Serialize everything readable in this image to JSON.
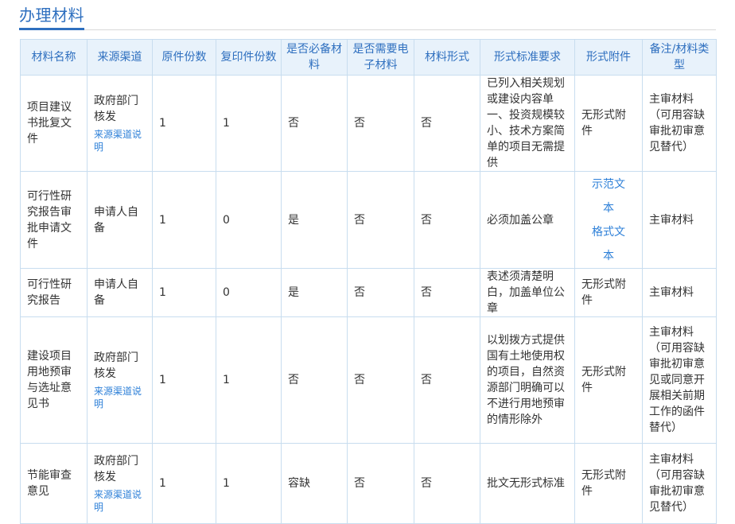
{
  "section": {
    "title": "办理材料"
  },
  "table": {
    "headers": {
      "name": "材料名称",
      "source": "来源渠道",
      "original": "原件份数",
      "copies": "复印件份数",
      "required": "是否必备材料",
      "electronic": "是否需要电子材料",
      "form": "材料形式",
      "standard": "形式标准要求",
      "attachment": "形式附件",
      "remark": "备注/材料类型"
    },
    "rows": [
      {
        "name": "项目建议书批复文件",
        "source": "政府部门核发",
        "source_note": "来源渠道说明",
        "original": "1",
        "copies": "1",
        "required": "否",
        "electronic": "否",
        "form": "否",
        "standard": "已列入相关规划或建设内容单一、投资规模较小、技术方案简单的项目无需提供",
        "attachment": "无形式附件",
        "remark": "主审材料（可用容缺审批初审意见替代）"
      },
      {
        "name": "可行性研究报告审批申请文件",
        "source": "申请人自备",
        "original": "1",
        "copies": "0",
        "required": "是",
        "electronic": "否",
        "form": "否",
        "standard": "必须加盖公章",
        "attachment_link1": "示范文本",
        "attachment_link2": "格式文本",
        "remark": "主审材料"
      },
      {
        "name": "可行性研究报告",
        "source": "申请人自备",
        "original": "1",
        "copies": "0",
        "required": "是",
        "electronic": "否",
        "form": "否",
        "standard": "表述须清楚明白，加盖单位公章",
        "attachment": "无形式附件",
        "remark": "主审材料"
      },
      {
        "name": "建设项目用地预审与选址意见书",
        "source": "政府部门核发",
        "source_note": "来源渠道说明",
        "original": "1",
        "copies": "1",
        "required": "否",
        "electronic": "否",
        "form": "否",
        "standard": "以划拨方式提供国有土地使用权的项目，自然资源部门明确可以不进行用地预审的情形除外",
        "attachment": "无形式附件",
        "remark": "主审材料（可用容缺审批初审意见或同意开展相关前期工作的函件替代）"
      },
      {
        "name": "节能审查意见",
        "source": "政府部门核发",
        "source_note": "来源渠道说明",
        "original": "1",
        "copies": "1",
        "required": "容缺",
        "electronic": "否",
        "form": "否",
        "standard": "批文无形式标准",
        "attachment": "无形式附件",
        "remark": "主审材料（可用容缺审批初审意见替代）"
      }
    ]
  }
}
